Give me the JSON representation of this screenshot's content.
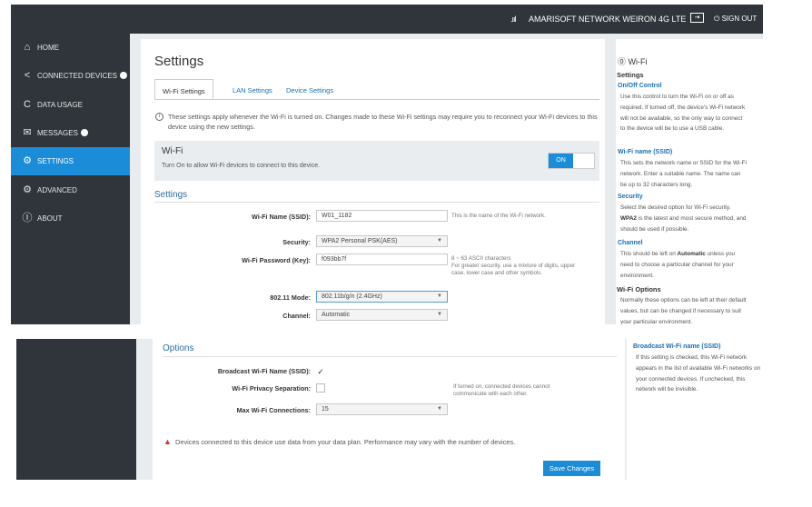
{
  "topbar": {
    "signal_icon": "signal-bars-icon",
    "network": "AMARISOFT NETWORK WEIRON",
    "tech": "4G LTE",
    "sign_out": "SIGN OUT"
  },
  "sidebar": {
    "items": [
      {
        "label": "HOME",
        "icon": "home-icon"
      },
      {
        "label": "CONNECTED DEVICES",
        "icon": "share-icon"
      },
      {
        "label": "DATA USAGE",
        "icon": "gauge-icon"
      },
      {
        "label": "MESSAGES",
        "icon": "message-icon"
      },
      {
        "label": "SETTINGS",
        "icon": "gear-icon"
      },
      {
        "label": "ADVANCED",
        "icon": "advanced-gear-icon"
      },
      {
        "label": "ABOUT",
        "icon": "info-icon"
      }
    ]
  },
  "main": {
    "title": "Settings",
    "tabs": [
      {
        "label": "Wi-Fi Settings"
      },
      {
        "label": "LAN Settings"
      },
      {
        "label": "Device Settings"
      }
    ],
    "info": "These settings apply whenever the Wi-Fi is turned on. Changes made to these Wi-Fi settings may require you to reconnect your Wi-Fi devices to this device using the new settings.",
    "wifi_box": {
      "title": "Wi-Fi",
      "desc": "Turn On to allow Wi-Fi devices to connect to this device.",
      "toggle": "ON"
    },
    "settings": {
      "heading": "Settings",
      "ssid_label": "Wi-Fi Name (SSID):",
      "ssid_value": "W01_1182",
      "ssid_hint": "This is the name of the Wi-Fi network.",
      "security_label": "Security:",
      "security_value": "WPA2 Personal PSK(AES)",
      "password_label": "Wi-Fi Password (Key):",
      "password_value": "f093bb7f",
      "password_hint_1": "8 ~ 63 ASCII characters",
      "password_hint_2": "For greater security, use a mixture of digits, upper case, lower case and other symbols.",
      "mode_label": "802.11 Mode:",
      "mode_value": "802.11b/g/n (2.4GHz)",
      "channel_label": "Channel:",
      "channel_value": "Automatic"
    },
    "options": {
      "heading": "Options",
      "broadcast_label": "Broadcast Wi-Fi Name (SSID):",
      "broadcast_checked": "✓",
      "privacy_label": "Wi-Fi Privacy Separation:",
      "privacy_hint": "If turned on, connected devices cannot communicate with each other.",
      "max_label": "Max Wi-Fi Connections:",
      "max_value": "15"
    },
    "warning": "Devices connected to this device use data from your data plan. Performance may vary with the number of devices.",
    "save_label": "Save Changes"
  },
  "help": {
    "title": "Wi-Fi",
    "section": "Settings",
    "onoff_title": "On/Off Control",
    "onoff_text": "Use this control to turn the Wi-Fi on or off as required. If turned off, the device's Wi-Fi network will not be available, so the only way to connect to the device will be to use a USB cable.",
    "ssid_title": "Wi-Fi name (SSID)",
    "ssid_text": "This sets the network name or SSID for the Wi-Fi network. Enter a suitable name. The name can be up to 32 characters long.",
    "security_title": "Security",
    "security_text_1": "Select the desired option for Wi-Fi security.",
    "security_text_bold": "WPA2",
    "security_text_2": " is the latest and most secure method, and should be used if possible.",
    "channel_title": "Channel",
    "channel_text_1": "This should be left on ",
    "channel_text_bold": "Automatic",
    "channel_text_2": " unless you need to choose a particular channel for your environment.",
    "options_title": "Wi-Fi Options",
    "options_text": "Normally these options can be left at their default values, but can be changed if necessary to suit your particular environment.",
    "broadcast_title": "Broadcast Wi-Fi name (SSID)",
    "broadcast_text": "If this setting is checked, this Wi-Fi network appears in the list of available Wi-Fi networks on your connected devices. If unchecked, this network will be invisible."
  },
  "colors": {
    "accent": "#1a8cd8",
    "sidebar": "#2f353b",
    "warning": "#d9342b"
  }
}
